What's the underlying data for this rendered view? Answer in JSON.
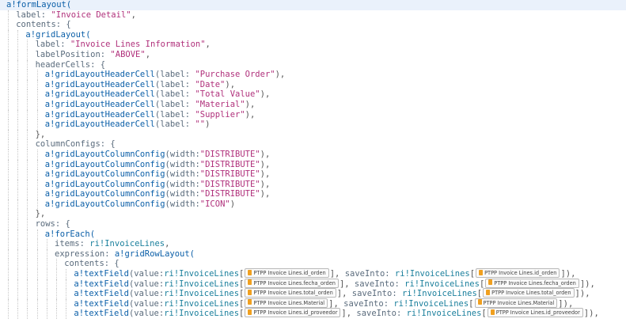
{
  "editor": {
    "lines": [
      {
        "indent": 0,
        "segs": [
          {
            "t": "fn",
            "v": "a!formLayout("
          }
        ]
      },
      {
        "indent": 1,
        "segs": [
          {
            "t": "key",
            "v": "label: "
          },
          {
            "t": "str",
            "v": "\"Invoice Detail\""
          },
          {
            "t": "punc",
            "v": ","
          }
        ]
      },
      {
        "indent": 1,
        "segs": [
          {
            "t": "key",
            "v": "contents: {"
          }
        ]
      },
      {
        "indent": 2,
        "segs": [
          {
            "t": "fn",
            "v": "a!gridLayout("
          }
        ]
      },
      {
        "indent": 3,
        "segs": [
          {
            "t": "key",
            "v": "label: "
          },
          {
            "t": "str",
            "v": "\"Invoice Lines Information\""
          },
          {
            "t": "punc",
            "v": ","
          }
        ]
      },
      {
        "indent": 3,
        "segs": [
          {
            "t": "key",
            "v": "labelPosition: "
          },
          {
            "t": "str",
            "v": "\"ABOVE\""
          },
          {
            "t": "punc",
            "v": ","
          }
        ]
      },
      {
        "indent": 3,
        "segs": [
          {
            "t": "key",
            "v": "headerCells: {"
          }
        ]
      },
      {
        "indent": 4,
        "segs": [
          {
            "t": "fn",
            "v": "a!gridLayoutHeaderCell"
          },
          {
            "t": "key",
            "v": "(label: "
          },
          {
            "t": "str",
            "v": "\"Purchase Order\""
          },
          {
            "t": "punc",
            "v": "),"
          }
        ]
      },
      {
        "indent": 4,
        "segs": [
          {
            "t": "fn",
            "v": "a!gridLayoutHeaderCell"
          },
          {
            "t": "key",
            "v": "(label: "
          },
          {
            "t": "str",
            "v": "\"Date\""
          },
          {
            "t": "punc",
            "v": "),"
          }
        ]
      },
      {
        "indent": 4,
        "segs": [
          {
            "t": "fn",
            "v": "a!gridLayoutHeaderCell"
          },
          {
            "t": "key",
            "v": "(label: "
          },
          {
            "t": "str",
            "v": "\"Total Value\""
          },
          {
            "t": "punc",
            "v": "),"
          }
        ]
      },
      {
        "indent": 4,
        "segs": [
          {
            "t": "fn",
            "v": "a!gridLayoutHeaderCell"
          },
          {
            "t": "key",
            "v": "(label: "
          },
          {
            "t": "str",
            "v": "\"Material\""
          },
          {
            "t": "punc",
            "v": "),"
          }
        ]
      },
      {
        "indent": 4,
        "segs": [
          {
            "t": "fn",
            "v": "a!gridLayoutHeaderCell"
          },
          {
            "t": "key",
            "v": "(label: "
          },
          {
            "t": "str",
            "v": "\"Supplier\""
          },
          {
            "t": "punc",
            "v": "),"
          }
        ]
      },
      {
        "indent": 4,
        "segs": [
          {
            "t": "fn",
            "v": "a!gridLayoutHeaderCell"
          },
          {
            "t": "key",
            "v": "(label: "
          },
          {
            "t": "str",
            "v": "\"\""
          },
          {
            "t": "punc",
            "v": ")"
          }
        ]
      },
      {
        "indent": 3,
        "segs": [
          {
            "t": "punc",
            "v": "},"
          }
        ]
      },
      {
        "indent": 3,
        "segs": [
          {
            "t": "key",
            "v": "columnConfigs: {"
          }
        ]
      },
      {
        "indent": 4,
        "segs": [
          {
            "t": "fn",
            "v": "a!gridLayoutColumnConfig"
          },
          {
            "t": "key",
            "v": "(width:"
          },
          {
            "t": "str",
            "v": "\"DISTRIBUTE\""
          },
          {
            "t": "punc",
            "v": "),"
          }
        ]
      },
      {
        "indent": 4,
        "segs": [
          {
            "t": "fn",
            "v": "a!gridLayoutColumnConfig"
          },
          {
            "t": "key",
            "v": "(width:"
          },
          {
            "t": "str",
            "v": "\"DISTRIBUTE\""
          },
          {
            "t": "punc",
            "v": "),"
          }
        ]
      },
      {
        "indent": 4,
        "segs": [
          {
            "t": "fn",
            "v": "a!gridLayoutColumnConfig"
          },
          {
            "t": "key",
            "v": "(width:"
          },
          {
            "t": "str",
            "v": "\"DISTRIBUTE\""
          },
          {
            "t": "punc",
            "v": "),"
          }
        ]
      },
      {
        "indent": 4,
        "segs": [
          {
            "t": "fn",
            "v": "a!gridLayoutColumnConfig"
          },
          {
            "t": "key",
            "v": "(width:"
          },
          {
            "t": "str",
            "v": "\"DISTRIBUTE\""
          },
          {
            "t": "punc",
            "v": "),"
          }
        ]
      },
      {
        "indent": 4,
        "segs": [
          {
            "t": "fn",
            "v": "a!gridLayoutColumnConfig"
          },
          {
            "t": "key",
            "v": "(width:"
          },
          {
            "t": "str",
            "v": "\"DISTRIBUTE\""
          },
          {
            "t": "punc",
            "v": "),"
          }
        ]
      },
      {
        "indent": 4,
        "segs": [
          {
            "t": "fn",
            "v": "a!gridLayoutColumnConfig"
          },
          {
            "t": "key",
            "v": "(width:"
          },
          {
            "t": "str",
            "v": "\"ICON\""
          },
          {
            "t": "punc",
            "v": ")"
          }
        ]
      },
      {
        "indent": 3,
        "segs": [
          {
            "t": "punc",
            "v": "},"
          }
        ]
      },
      {
        "indent": 3,
        "segs": [
          {
            "t": "key",
            "v": "rows: {"
          }
        ]
      },
      {
        "indent": 4,
        "segs": [
          {
            "t": "fn",
            "v": "a!forEach("
          }
        ]
      },
      {
        "indent": 5,
        "segs": [
          {
            "t": "key",
            "v": "items: "
          },
          {
            "t": "ri",
            "v": "ri!InvoiceLines"
          },
          {
            "t": "punc",
            "v": ","
          }
        ]
      },
      {
        "indent": 5,
        "segs": [
          {
            "t": "key",
            "v": "expression: "
          },
          {
            "t": "fn",
            "v": "a!gridRowLayout("
          }
        ]
      },
      {
        "indent": 6,
        "segs": [
          {
            "t": "key",
            "v": "contents: {"
          }
        ]
      },
      {
        "indent": 7,
        "segs": [
          {
            "t": "fn",
            "v": "a!textField"
          },
          {
            "t": "key",
            "v": "(value:"
          },
          {
            "t": "ri",
            "v": "ri!InvoiceLines"
          },
          {
            "t": "punc",
            "v": "["
          },
          {
            "t": "chip",
            "v": "PTPP Invoice Lines.id_orden"
          },
          {
            "t": "punc",
            "v": "], "
          },
          {
            "t": "key",
            "v": "saveInto: "
          },
          {
            "t": "ri",
            "v": "ri!InvoiceLines"
          },
          {
            "t": "punc",
            "v": "["
          },
          {
            "t": "chip",
            "v": "PTPP Invoice Lines.id_orden"
          },
          {
            "t": "punc",
            "v": "]),"
          }
        ]
      },
      {
        "indent": 7,
        "segs": [
          {
            "t": "fn",
            "v": "a!textField"
          },
          {
            "t": "key",
            "v": "(value:"
          },
          {
            "t": "ri",
            "v": "ri!InvoiceLines"
          },
          {
            "t": "punc",
            "v": "["
          },
          {
            "t": "chip",
            "v": "PTPP Invoice Lines.fecha_orden"
          },
          {
            "t": "punc",
            "v": "], "
          },
          {
            "t": "key",
            "v": "saveInto: "
          },
          {
            "t": "ri",
            "v": "ri!InvoiceLines"
          },
          {
            "t": "punc",
            "v": "["
          },
          {
            "t": "chip",
            "v": "PTPP Invoice Lines.fecha_orden"
          },
          {
            "t": "punc",
            "v": "]),"
          }
        ]
      },
      {
        "indent": 7,
        "segs": [
          {
            "t": "fn",
            "v": "a!textField"
          },
          {
            "t": "key",
            "v": "(value:"
          },
          {
            "t": "ri",
            "v": "ri!InvoiceLines"
          },
          {
            "t": "punc",
            "v": "["
          },
          {
            "t": "chip",
            "v": "PTPP Invoice Lines.total_orden"
          },
          {
            "t": "punc",
            "v": "], "
          },
          {
            "t": "key",
            "v": "saveInto: "
          },
          {
            "t": "ri",
            "v": "ri!InvoiceLines"
          },
          {
            "t": "punc",
            "v": "["
          },
          {
            "t": "chip",
            "v": "PTPP Invoice Lines.total_orden"
          },
          {
            "t": "punc",
            "v": "]),"
          }
        ]
      },
      {
        "indent": 7,
        "segs": [
          {
            "t": "fn",
            "v": "a!textField"
          },
          {
            "t": "key",
            "v": "(value:"
          },
          {
            "t": "ri",
            "v": "ri!InvoiceLines"
          },
          {
            "t": "punc",
            "v": "["
          },
          {
            "t": "chip",
            "v": "PTPP Invoice Lines.Material"
          },
          {
            "t": "punc",
            "v": "], "
          },
          {
            "t": "key",
            "v": "saveInto: "
          },
          {
            "t": "ri",
            "v": "ri!InvoiceLines"
          },
          {
            "t": "punc",
            "v": "["
          },
          {
            "t": "chip",
            "v": "PTPP Invoice Lines.Material"
          },
          {
            "t": "punc",
            "v": "]),"
          }
        ]
      },
      {
        "indent": 7,
        "segs": [
          {
            "t": "fn",
            "v": "a!textField"
          },
          {
            "t": "key",
            "v": "(value:"
          },
          {
            "t": "ri",
            "v": "ri!InvoiceLines"
          },
          {
            "t": "punc",
            "v": "["
          },
          {
            "t": "chip",
            "v": "PTPP Invoice Lines.id_proveedor"
          },
          {
            "t": "punc",
            "v": "], "
          },
          {
            "t": "key",
            "v": "saveInto: "
          },
          {
            "t": "ri",
            "v": "ri!InvoiceLines"
          },
          {
            "t": "punc",
            "v": "["
          },
          {
            "t": "chip",
            "v": "PTPP Invoice Lines.id_proveedor"
          },
          {
            "t": "punc",
            "v": "]),"
          }
        ]
      }
    ]
  }
}
